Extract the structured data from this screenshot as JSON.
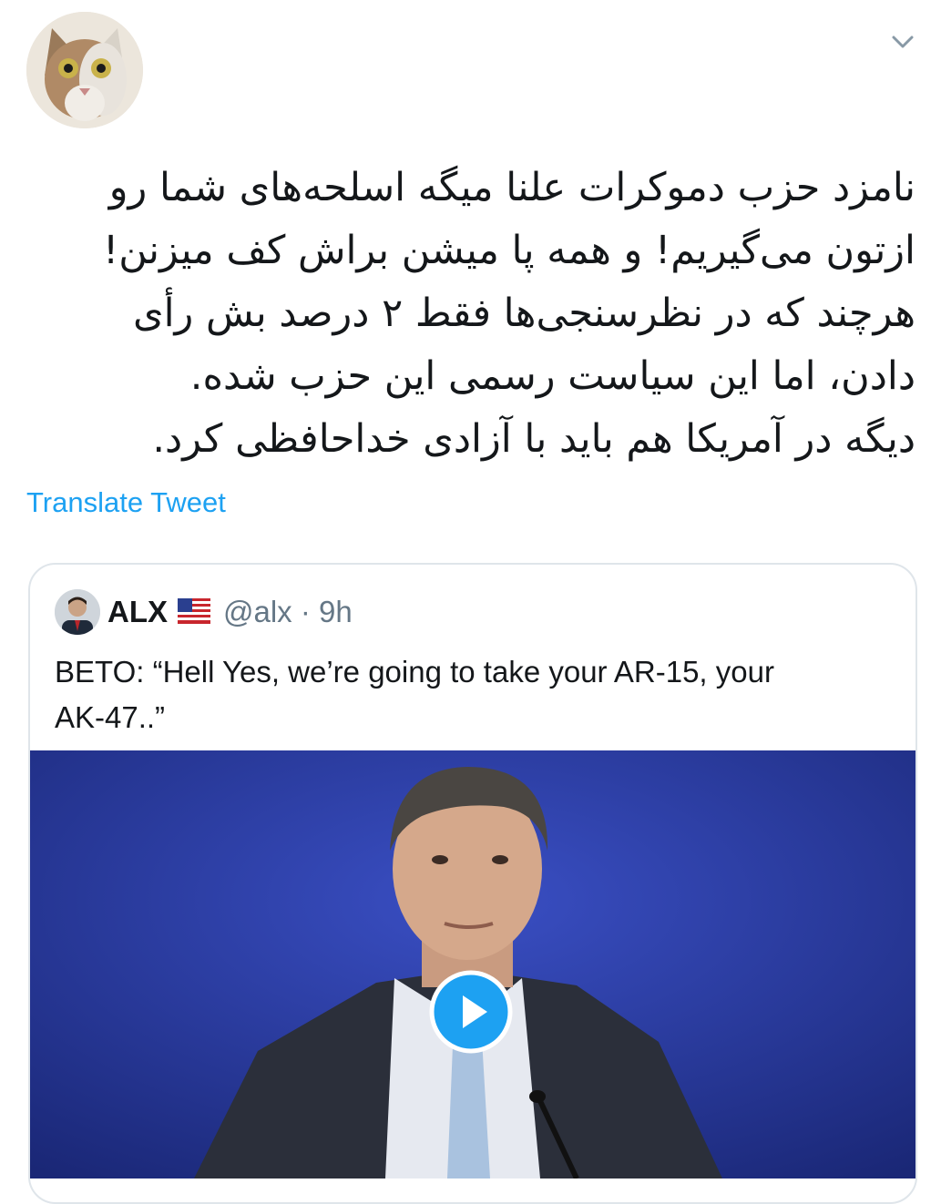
{
  "tweet": {
    "lines": [
      "نامزد حزب دموکرات علنا میگه اسلحه‌های شما رو",
      "ازتون می‌گیریم! و همه پا میشن براش کف میزنن!",
      "هرچند که در نظرسنجی‌ها فقط ۲ درصد بش رأی",
      "دادن، اما این سیاست رسمی این حزب شده.",
      "دیگه در آمریکا هم باید با آزادی خداحافظی کرد."
    ],
    "translate_label": "Translate Tweet"
  },
  "quoted": {
    "name": "ALX",
    "meta": "@alx · 9h",
    "text_line1": "BETO: “Hell Yes, we’re going to take your AR-15, your",
    "text_line2": "AK-47..”"
  },
  "icons": {
    "menu": "chevron-down-icon",
    "flag": "us-flag-icon",
    "play": "play-icon"
  },
  "colors": {
    "link": "#1da1f2",
    "text": "#14171a",
    "secondary": "#657786",
    "border": "#dfe5ea",
    "media_bg": "#21338f"
  }
}
